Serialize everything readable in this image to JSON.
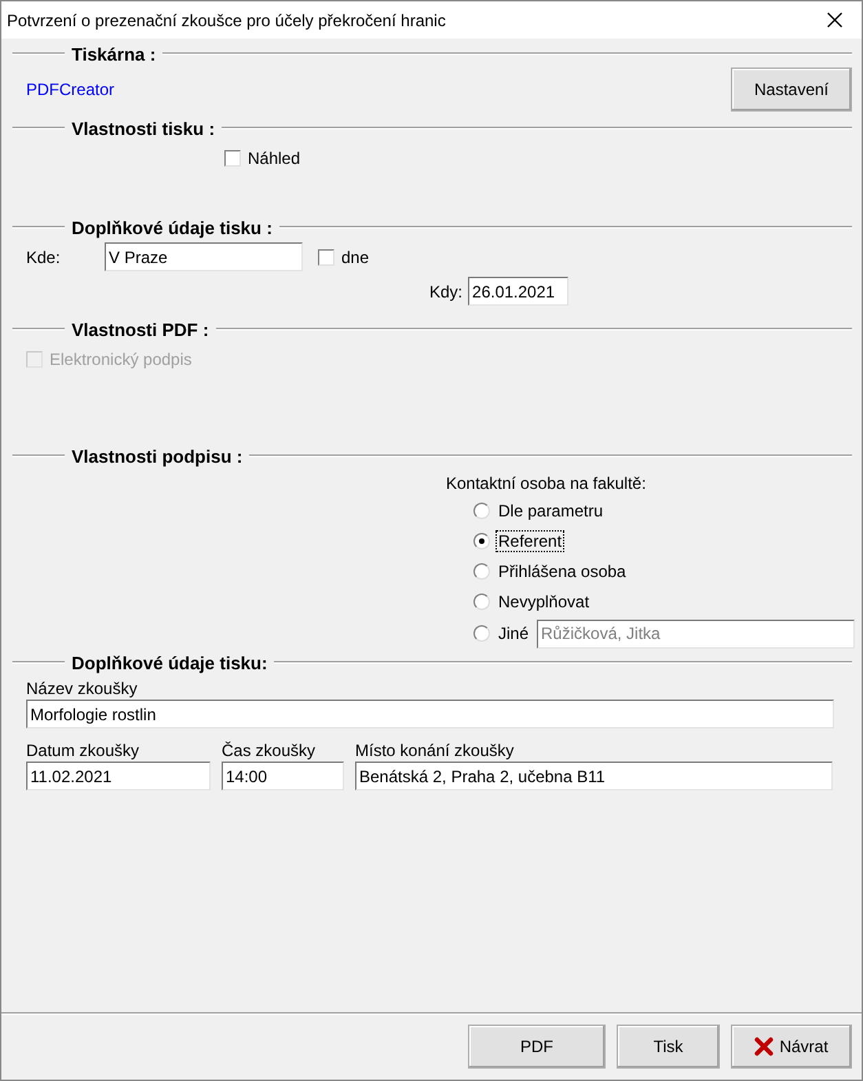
{
  "window": {
    "title": "Potvrzení o prezenační zkoušce pro účely překročení hranic"
  },
  "printer": {
    "heading": "Tiskárna :",
    "name": "PDFCreator",
    "settings_button": "Nastavení"
  },
  "print_properties": {
    "heading": "Vlastnosti tisku :",
    "preview": {
      "label": "Náhled",
      "checked": false
    }
  },
  "print_details": {
    "heading": "Doplňkové údaje tisku :",
    "where_label": "Kde:",
    "where_value": "V Praze",
    "date_checkbox": {
      "label": "dne",
      "checked": false
    },
    "when_label": "Kdy:",
    "when_value": "26.01.2021"
  },
  "pdf_properties": {
    "heading": "Vlastnosti PDF :",
    "e_signature": {
      "label": "Elektronický podpis",
      "checked": false,
      "disabled": true
    }
  },
  "signature_properties": {
    "heading": "Vlastnosti podpisu :",
    "contact_label": "Kontaktní osoba na fakultě:",
    "options": [
      {
        "label": "Dle parametru",
        "selected": false
      },
      {
        "label": "Referent",
        "selected": true
      },
      {
        "label": "Přihlášena osoba",
        "selected": false
      },
      {
        "label": "Nevyplňovat",
        "selected": false
      },
      {
        "label": "Jiné",
        "selected": false,
        "field": {
          "value": "Růžičková, Jitka",
          "disabled": true
        }
      }
    ]
  },
  "exam_details": {
    "heading": "Doplňkové údaje tisku:",
    "name": {
      "label": "Název zkoušky",
      "value": "Morfologie rostlin"
    },
    "fields": [
      {
        "label": "Datum zkoušky",
        "value": "11.02.2021"
      },
      {
        "label": "Čas zkoušky",
        "value": "14:00"
      },
      {
        "label": "Místo konání zkoušky",
        "value": "Benátská 2, Praha 2, učebna B11"
      }
    ]
  },
  "buttons": [
    {
      "label": "PDF",
      "kind": "plain"
    },
    {
      "label": "Tisk",
      "kind": "plain"
    },
    {
      "label": "Návrat",
      "kind": "cancel"
    }
  ]
}
